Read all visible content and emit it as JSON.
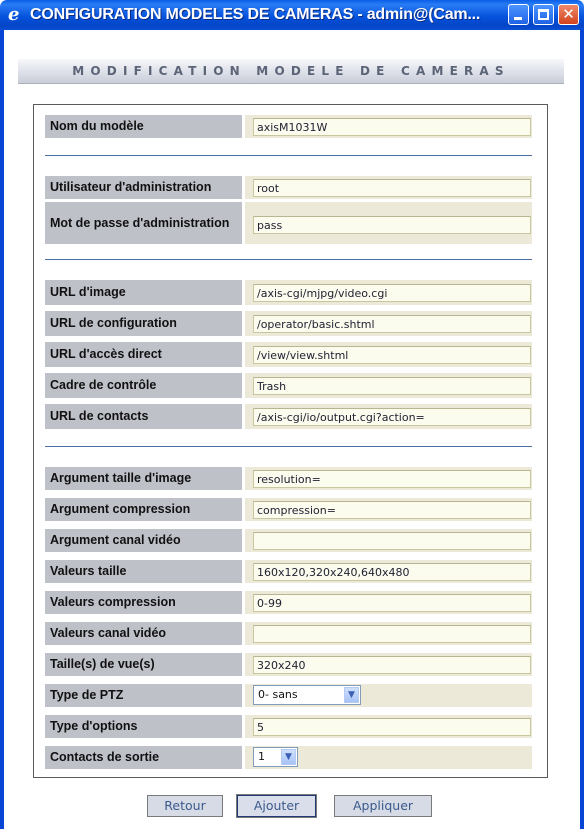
{
  "window": {
    "title": "CONFIGURATION MODELES DE CAMERAS - admin@(Cam...",
    "buttons": {
      "minimize": "minimize",
      "maximize": "maximize",
      "close": "✕"
    }
  },
  "page": {
    "title": "MODIFICATION MODELE DE CAMERAS"
  },
  "fields": {
    "model_name": {
      "label": "Nom du modèle",
      "value": "axisM1031W"
    },
    "admin_user": {
      "label": "Utilisateur d'administration",
      "value": "root"
    },
    "admin_password": {
      "label": "Mot de passe d'administration",
      "value": "pass"
    },
    "image_url": {
      "label": "URL d'image",
      "value": "/axis-cgi/mjpg/video.cgi"
    },
    "config_url": {
      "label": "URL de configuration",
      "value": "/operator/basic.shtml"
    },
    "direct_url": {
      "label": "URL d'accès direct",
      "value": "/view/view.shtml"
    },
    "control_frame": {
      "label": "Cadre de contrôle",
      "value": "Trash"
    },
    "contacts_url": {
      "label": "URL de contacts",
      "value": "/axis-cgi/io/output.cgi?action="
    },
    "image_size_arg": {
      "label": "Argument taille d'image",
      "value": "resolution="
    },
    "compression_arg": {
      "label": "Argument compression",
      "value": "compression="
    },
    "video_channel_arg": {
      "label": "Argument canal vidéo",
      "value": ""
    },
    "size_values": {
      "label": "Valeurs taille",
      "value": "160x120,320x240,640x480"
    },
    "compression_values": {
      "label": "Valeurs compression",
      "value": "0-99"
    },
    "video_channel_values": {
      "label": "Valeurs canal vidéo",
      "value": ""
    },
    "view_sizes": {
      "label": "Taille(s) de vue(s)",
      "value": "320x240"
    },
    "ptz_type": {
      "label": "Type de PTZ",
      "value": "0- sans"
    },
    "options_type": {
      "label": "Type d'options",
      "value": "5"
    },
    "output_contacts": {
      "label": "Contacts de sortie",
      "value": "1"
    }
  },
  "actions": {
    "back": "Retour",
    "add": "Ajouter",
    "apply": "Appliquer"
  },
  "colors": {
    "title_bar": "#0653dd",
    "label_bg": "#bfc1c9",
    "input_bg": "#fbfbee",
    "separator": "#4b6ea5"
  }
}
